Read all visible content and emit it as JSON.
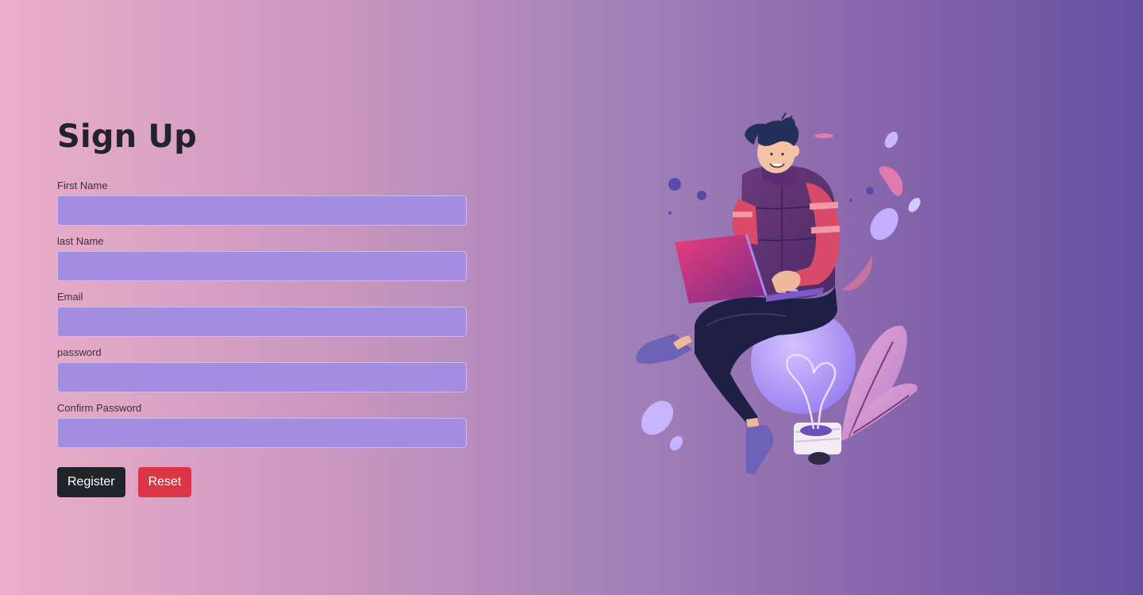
{
  "form": {
    "title": "Sign Up",
    "fields": [
      {
        "label": "First Name",
        "value": "",
        "placeholder": ""
      },
      {
        "label": "last Name",
        "value": "",
        "placeholder": ""
      },
      {
        "label": "Email",
        "value": "",
        "placeholder": ""
      },
      {
        "label": "password",
        "value": "",
        "placeholder": ""
      },
      {
        "label": "Confirm Password",
        "value": "",
        "placeholder": ""
      }
    ],
    "register_label": "Register",
    "reset_label": "Reset"
  },
  "illustration": {
    "icon": "person-on-lightbulb-with-laptop"
  },
  "colors": {
    "gradient_start": "#ebaec9",
    "gradient_end": "#6550a0",
    "input_fill": "#a48de0",
    "register_button": "#212529",
    "reset_button": "#dc3545",
    "title_text": "#22212e"
  }
}
